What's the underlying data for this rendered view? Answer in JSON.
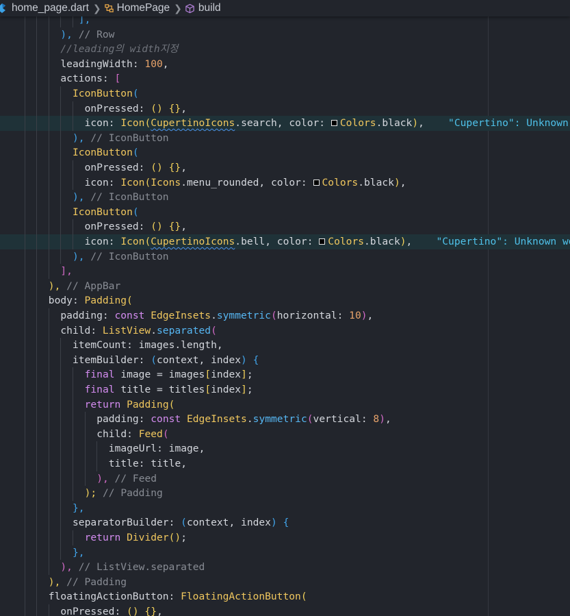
{
  "breadcrumb": {
    "file": "home_page.dart",
    "class": "HomePage",
    "method": "build"
  },
  "colors": {
    "background": "#22252c",
    "highlight_line": "#1f3238",
    "keyword": "#d48cf0",
    "class_name": "#f0c75e",
    "number": "#e8a46b",
    "comment": "#888c94",
    "warning_text": "#4fc1e9"
  },
  "code_lines": [
    {
      "tokens": [
        [
          "b",
          "],"
        ]
      ]
    },
    {
      "tokens": [
        [
          "b",
          "),"
        ],
        [
          "c",
          " // Row"
        ]
      ]
    },
    {
      "tokens": [
        [
          "ci",
          "//leading의 width지정"
        ]
      ]
    },
    {
      "tokens": [
        [
          "p",
          "leadingWidth: "
        ],
        [
          "n",
          "100"
        ],
        [
          "p",
          ","
        ]
      ]
    },
    {
      "tokens": [
        [
          "p",
          "actions: "
        ],
        [
          "pu",
          "["
        ]
      ]
    },
    {
      "tokens": [
        [
          "y",
          "IconButton"
        ],
        [
          "b",
          "("
        ]
      ]
    },
    {
      "tokens": [
        [
          "p",
          "onPressed: "
        ],
        [
          "y2",
          "()"
        ],
        [
          "p",
          " "
        ],
        [
          "y2",
          "{}"
        ],
        [
          "p",
          ","
        ]
      ]
    },
    {
      "hl": true,
      "tokens": [
        [
          "p",
          "icon: "
        ],
        [
          "y",
          "Icon"
        ],
        [
          "y2",
          "("
        ],
        [
          "yw",
          "CupertinoIcons"
        ],
        [
          "p",
          ".search, color: "
        ],
        [
          "sw",
          ""
        ],
        [
          "y",
          "Colors"
        ],
        [
          "p",
          ".black"
        ],
        [
          "y2",
          ")"
        ],
        [
          "p",
          ",    "
        ],
        [
          "s",
          "\"Cupertino\": Unknown"
        ]
      ]
    },
    {
      "tokens": [
        [
          "b",
          "),"
        ],
        [
          "c",
          " // IconButton"
        ]
      ]
    },
    {
      "tokens": [
        [
          "y",
          "IconButton"
        ],
        [
          "b",
          "("
        ]
      ]
    },
    {
      "tokens": [
        [
          "p",
          "onPressed: "
        ],
        [
          "y2",
          "()"
        ],
        [
          "p",
          " "
        ],
        [
          "y2",
          "{}"
        ],
        [
          "p",
          ","
        ]
      ]
    },
    {
      "tokens": [
        [
          "p",
          "icon: "
        ],
        [
          "y",
          "Icon"
        ],
        [
          "y2",
          "("
        ],
        [
          "y",
          "Icons"
        ],
        [
          "p",
          ".menu_rounded, color: "
        ],
        [
          "sw",
          ""
        ],
        [
          "y",
          "Colors"
        ],
        [
          "p",
          ".black"
        ],
        [
          "y2",
          ")"
        ],
        [
          "p",
          ","
        ]
      ]
    },
    {
      "tokens": [
        [
          "b",
          "),"
        ],
        [
          "c",
          " // IconButton"
        ]
      ]
    },
    {
      "tokens": [
        [
          "y",
          "IconButton"
        ],
        [
          "b",
          "("
        ]
      ]
    },
    {
      "tokens": [
        [
          "p",
          "onPressed: "
        ],
        [
          "y2",
          "()"
        ],
        [
          "p",
          " "
        ],
        [
          "y2",
          "{}"
        ],
        [
          "p",
          ","
        ]
      ]
    },
    {
      "hl": true,
      "tokens": [
        [
          "p",
          "icon: "
        ],
        [
          "y",
          "Icon"
        ],
        [
          "y2",
          "("
        ],
        [
          "yw",
          "CupertinoIcons"
        ],
        [
          "p",
          ".bell, color: "
        ],
        [
          "sw",
          ""
        ],
        [
          "y",
          "Colors"
        ],
        [
          "p",
          ".black"
        ],
        [
          "y2",
          ")"
        ],
        [
          "p",
          ",    "
        ],
        [
          "s",
          "\"Cupertino\": Unknown wo"
        ]
      ]
    },
    {
      "tokens": [
        [
          "b",
          "),"
        ],
        [
          "c",
          " // IconButton"
        ]
      ]
    },
    {
      "tokens": [
        [
          "pu",
          "],"
        ]
      ]
    },
    {
      "tokens": [
        [
          "y2",
          "),"
        ],
        [
          "c",
          " // AppBar"
        ]
      ]
    },
    {
      "tokens": [
        [
          "p",
          "body: "
        ],
        [
          "y",
          "Padding"
        ],
        [
          "y2",
          "("
        ]
      ]
    },
    {
      "tokens": [
        [
          "p",
          "padding: "
        ],
        [
          "k",
          "const "
        ],
        [
          "y",
          "EdgeInsets"
        ],
        [
          "p",
          "."
        ],
        [
          "f",
          "symmetric"
        ],
        [
          "pu",
          "("
        ],
        [
          "p",
          "horizontal: "
        ],
        [
          "n",
          "10"
        ],
        [
          "pu",
          ")"
        ],
        [
          "p",
          ","
        ]
      ]
    },
    {
      "tokens": [
        [
          "p",
          "child: "
        ],
        [
          "y",
          "ListView"
        ],
        [
          "p",
          "."
        ],
        [
          "f",
          "separated"
        ],
        [
          "pu",
          "("
        ]
      ]
    },
    {
      "tokens": [
        [
          "p",
          "itemCount: images.length,"
        ]
      ]
    },
    {
      "tokens": [
        [
          "p",
          "itemBuilder: "
        ],
        [
          "b",
          "("
        ],
        [
          "p",
          "context, index"
        ],
        [
          "b",
          ")"
        ],
        [
          "p",
          " "
        ],
        [
          "b",
          "{"
        ]
      ]
    },
    {
      "tokens": [
        [
          "k",
          "final "
        ],
        [
          "p",
          "image = images"
        ],
        [
          "y2",
          "["
        ],
        [
          "p",
          "index"
        ],
        [
          "y2",
          "]"
        ],
        [
          "p",
          ";"
        ]
      ]
    },
    {
      "tokens": [
        [
          "k",
          "final "
        ],
        [
          "p",
          "title = titles"
        ],
        [
          "y2",
          "["
        ],
        [
          "p",
          "index"
        ],
        [
          "y2",
          "]"
        ],
        [
          "p",
          ";"
        ]
      ]
    },
    {
      "tokens": [
        [
          "k",
          "return "
        ],
        [
          "y",
          "Padding"
        ],
        [
          "y2",
          "("
        ]
      ]
    },
    {
      "tokens": [
        [
          "p",
          "padding: "
        ],
        [
          "k",
          "const "
        ],
        [
          "y",
          "EdgeInsets"
        ],
        [
          "p",
          "."
        ],
        [
          "f",
          "symmetric"
        ],
        [
          "pu",
          "("
        ],
        [
          "p",
          "vertical: "
        ],
        [
          "n",
          "8"
        ],
        [
          "pu",
          ")"
        ],
        [
          "p",
          ","
        ]
      ]
    },
    {
      "tokens": [
        [
          "p",
          "child: "
        ],
        [
          "y",
          "Feed"
        ],
        [
          "pu",
          "("
        ]
      ]
    },
    {
      "tokens": [
        [
          "p",
          "imageUrl: image,"
        ]
      ]
    },
    {
      "tokens": [
        [
          "p",
          "title: title,"
        ]
      ]
    },
    {
      "tokens": [
        [
          "pu",
          "),"
        ],
        [
          "c",
          " // Feed"
        ]
      ]
    },
    {
      "tokens": [
        [
          "y2",
          ");"
        ],
        [
          "c",
          " // Padding"
        ]
      ]
    },
    {
      "tokens": [
        [
          "b",
          "},"
        ]
      ]
    },
    {
      "tokens": [
        [
          "p",
          "separatorBuilder: "
        ],
        [
          "b",
          "("
        ],
        [
          "p",
          "context, index"
        ],
        [
          "b",
          ")"
        ],
        [
          "p",
          " "
        ],
        [
          "b",
          "{"
        ]
      ]
    },
    {
      "tokens": [
        [
          "k",
          "return "
        ],
        [
          "y",
          "Divider"
        ],
        [
          "y2",
          "()"
        ],
        [
          "p",
          ";"
        ]
      ]
    },
    {
      "tokens": [
        [
          "b",
          "},"
        ]
      ]
    },
    {
      "tokens": [
        [
          "pu",
          "),"
        ],
        [
          "c",
          " // ListView.separated"
        ]
      ]
    },
    {
      "tokens": [
        [
          "y2",
          "),"
        ],
        [
          "c",
          " // Padding"
        ]
      ]
    },
    {
      "tokens": [
        [
          "p",
          "floatingActionButton: "
        ],
        [
          "y",
          "FloatingActionButton"
        ],
        [
          "y2",
          "("
        ]
      ]
    },
    {
      "tokens": [
        [
          "p",
          "onPressed: "
        ],
        [
          "y2",
          "()"
        ],
        [
          "p",
          " "
        ],
        [
          "y2",
          "{}"
        ],
        [
          "p",
          ","
        ]
      ]
    }
  ]
}
